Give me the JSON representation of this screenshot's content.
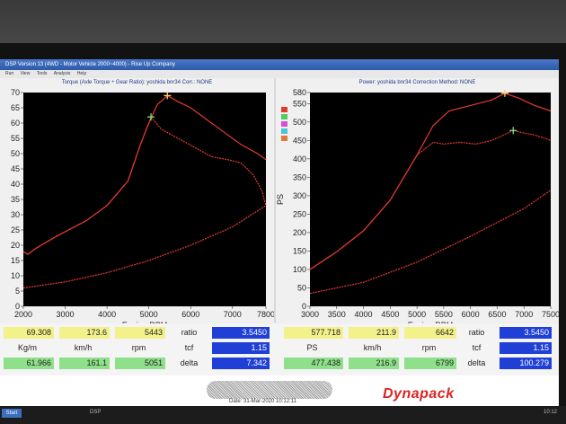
{
  "window": {
    "title": "DSP Version 13 (4WD - Motor Vehicle 2000~4000) - Rise Up Company",
    "menu": [
      "Run",
      "View",
      "Tools",
      "Analysis",
      "Help"
    ]
  },
  "left_panel": {
    "header": "Torque (Axle Torque ÷ Gear Ratio): yoshida bnr34    Corr.: NONE",
    "xlabel": "Engine RPM",
    "yticks": [
      "70",
      "65",
      "60",
      "55",
      "50",
      "45",
      "40",
      "35",
      "30",
      "25",
      "20",
      "15",
      "10",
      "5",
      "0"
    ],
    "xticks": [
      "2000",
      "3000",
      "4000",
      "5000",
      "6000",
      "7000",
      "7800"
    ]
  },
  "right_panel": {
    "header": "Power: yoshida bnr34    Correction Method: NONE",
    "ylabel": "PS",
    "xlabel": "Engine RPM",
    "yticks": [
      "580",
      "550",
      "500",
      "450",
      "400",
      "350",
      "300",
      "250",
      "200",
      "150",
      "100",
      "50",
      "0"
    ],
    "xticks": [
      "3000",
      "3500",
      "4000",
      "4500",
      "5000",
      "5500",
      "6000",
      "6500",
      "7000",
      "7500"
    ]
  },
  "chart_data": [
    {
      "type": "line",
      "title": "",
      "xlabel": "Engine RPM",
      "ylabel": "",
      "xlim": [
        2000,
        7800
      ],
      "ylim": [
        0,
        70
      ],
      "series": [
        {
          "x": [
            2000,
            2100,
            2300,
            2800,
            3500,
            4000,
            4500,
            4800,
            5000,
            5200,
            5443,
            5700,
            6000,
            6400,
            6800,
            7200,
            7600,
            7800
          ],
          "y": [
            18,
            17,
            19,
            23,
            28,
            33,
            41,
            53,
            60,
            66,
            69,
            67,
            65,
            61,
            57,
            53,
            50,
            48
          ]
        },
        {
          "x": [
            2000,
            2100,
            2300,
            2800,
            3500,
            4000,
            4500,
            4800,
            5000,
            5051,
            5300,
            5700,
            6100,
            6500,
            6900,
            7200,
            7500,
            7700,
            7800
          ],
          "y": [
            18,
            17,
            19,
            23,
            28,
            33,
            41,
            53,
            60,
            62,
            58,
            55,
            52,
            49,
            48,
            47,
            43,
            38,
            33
          ]
        },
        {
          "x": [
            2000,
            3000,
            4000,
            5000,
            6000,
            7000,
            7800
          ],
          "y": [
            6,
            8,
            11,
            15,
            20,
            26,
            33
          ]
        }
      ],
      "markers": [
        {
          "x": 5443,
          "y": 69,
          "color": "#f5d66a"
        },
        {
          "x": 5051,
          "y": 62,
          "color": "#7be07b"
        }
      ]
    },
    {
      "type": "line",
      "title": "",
      "xlabel": "Engine RPM",
      "ylabel": "PS",
      "xlim": [
        3000,
        7500
      ],
      "ylim": [
        0,
        580
      ],
      "series": [
        {
          "x": [
            3000,
            3500,
            4000,
            4500,
            5000,
            5300,
            5600,
            6000,
            6400,
            6642,
            6900,
            7200,
            7500
          ],
          "y": [
            100,
            148,
            205,
            288,
            410,
            490,
            530,
            545,
            560,
            578,
            565,
            545,
            530
          ]
        },
        {
          "x": [
            3000,
            3500,
            4000,
            4500,
            5000,
            5300,
            5500,
            5800,
            6100,
            6400,
            6799,
            7000,
            7200,
            7500
          ],
          "y": [
            100,
            148,
            205,
            288,
            410,
            445,
            440,
            445,
            440,
            450,
            477,
            470,
            465,
            450
          ]
        },
        {
          "x": [
            3000,
            4000,
            5000,
            6000,
            7000,
            7500
          ],
          "y": [
            35,
            65,
            120,
            190,
            265,
            315
          ]
        }
      ],
      "markers": [
        {
          "x": 6642,
          "y": 578,
          "color": "#f5d66a"
        },
        {
          "x": 6799,
          "y": 477,
          "color": "#7be07b"
        }
      ]
    }
  ],
  "readouts": {
    "left_row1": [
      "69.308",
      "173.6",
      "5443"
    ],
    "left_units": [
      "Kg/m",
      "km/h",
      "rpm"
    ],
    "left_row2": [
      "61.966",
      "161.1",
      "5051"
    ],
    "left_ratio_label": "ratio",
    "left_ratio": "3.5450",
    "left_tcf_label": "tcf",
    "left_tcf": "1.15",
    "left_delta_label": "delta",
    "left_delta": "7.342",
    "right_row1": [
      "577.718",
      "211.9",
      "6642"
    ],
    "right_units": [
      "PS",
      "km/h",
      "rpm"
    ],
    "right_row2": [
      "477.438",
      "216.9",
      "6799"
    ],
    "right_ratio_label": "ratio",
    "right_ratio": "3.5450",
    "right_tcf_label": "tcf",
    "right_tcf": "1.15",
    "right_delta_label": "delta",
    "right_delta": "100.279"
  },
  "footer": {
    "date": "Date: 31-Mar-2020 10:12:11",
    "logo": "Dynapack"
  },
  "taskbar": {
    "start": "Start",
    "item": "DSP",
    "clock": "10:12"
  },
  "colors": {
    "plot_bg": "#000000",
    "curve": "#e53a2f",
    "max_marker": "#f5d66a",
    "alt_marker": "#7be07b"
  }
}
